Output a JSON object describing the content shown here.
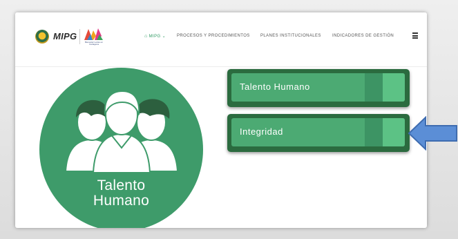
{
  "header": {
    "logo_text": "MIPG",
    "logo_mark_caption": "Bienestar Letras en Cartagena",
    "nav": [
      {
        "label": "MIPG",
        "caret": "⌄",
        "active": true
      },
      {
        "label": "PROCESOS Y PROCEDIMIENTOS",
        "active": false
      },
      {
        "label": "PLANES INSTITUCIONALES",
        "active": false
      },
      {
        "label": "INDICADORES DE GESTIÓN",
        "active": false
      }
    ]
  },
  "hero": {
    "title_line1": "Talento",
    "title_line2": "Humano"
  },
  "cards": [
    {
      "label": "Talento Humano"
    },
    {
      "label": "Integridad"
    }
  ],
  "colors": {
    "green_circle": "#3e9b6a",
    "card_border": "#2b6b3f",
    "card_fill": "#4caa73",
    "arrow": "#5b8ed6"
  }
}
